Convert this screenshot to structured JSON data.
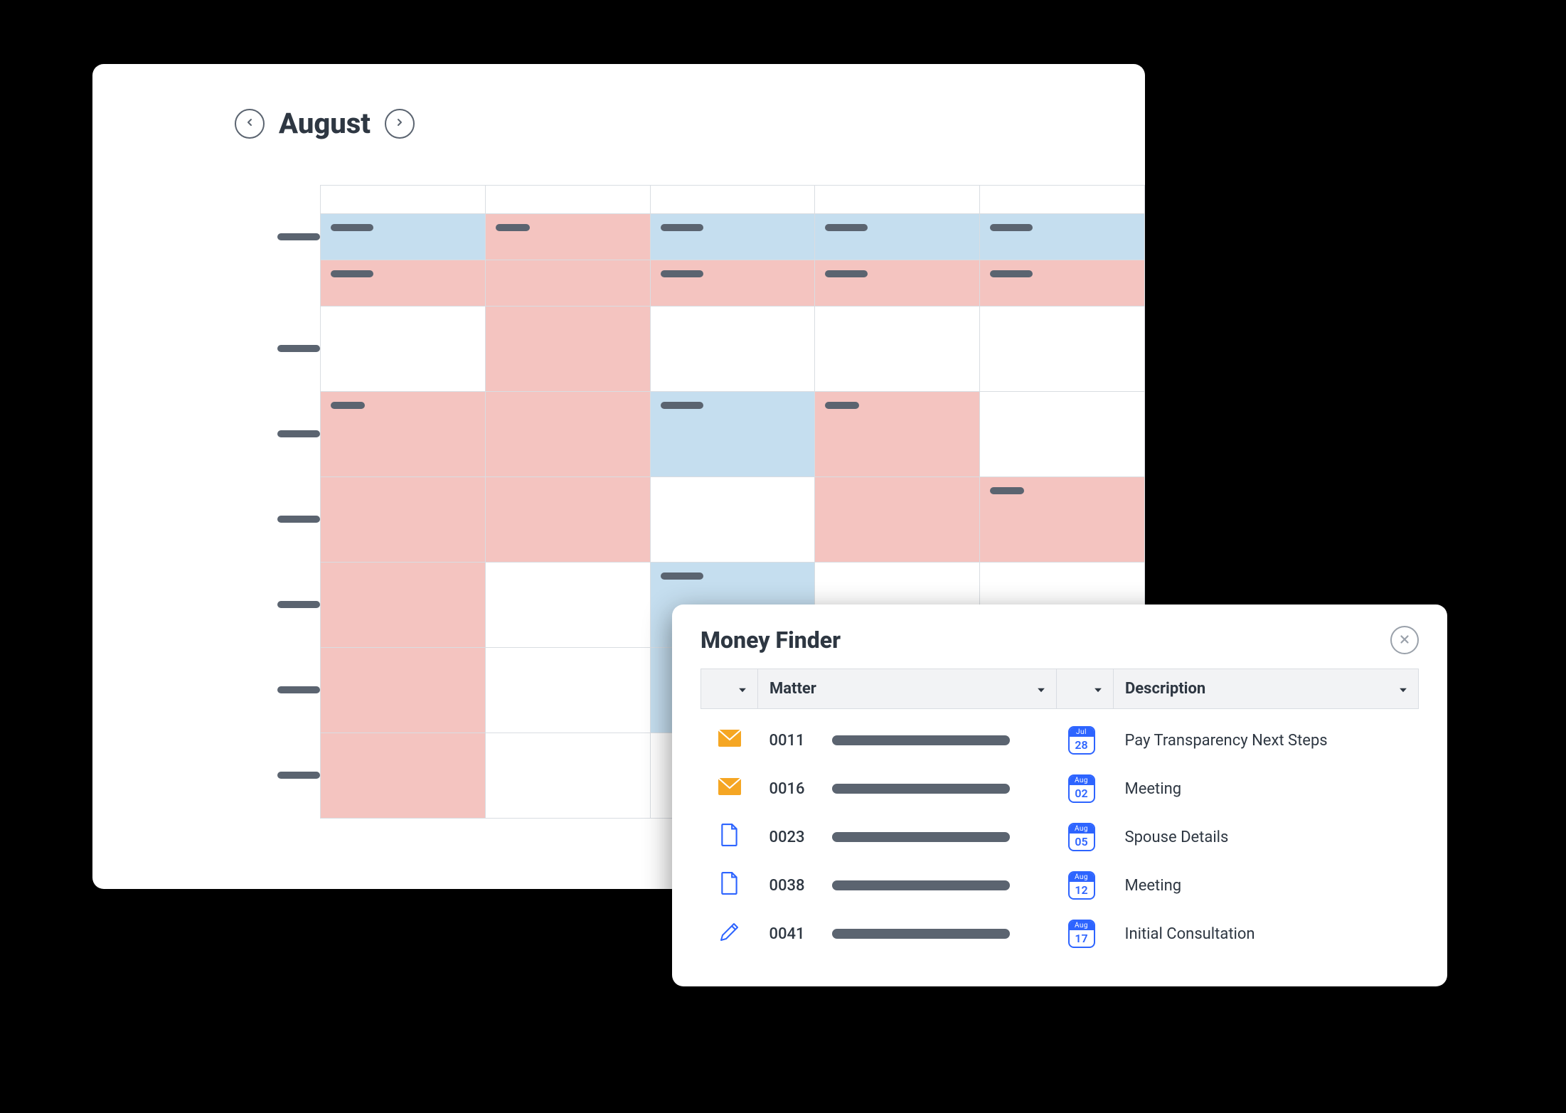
{
  "calendar": {
    "month_label": "August"
  },
  "money_finder": {
    "title": "Money Finder",
    "columns": {
      "matter": "Matter",
      "description": "Description"
    },
    "rows": [
      {
        "icon": "mail",
        "matter_id": "0011",
        "date_month": "Jul",
        "date_day": "28",
        "description": "Pay Transparency Next Steps"
      },
      {
        "icon": "mail",
        "matter_id": "0016",
        "date_month": "Aug",
        "date_day": "02",
        "description": "Meeting"
      },
      {
        "icon": "doc",
        "matter_id": "0023",
        "date_month": "Aug",
        "date_day": "05",
        "description": "Spouse Details"
      },
      {
        "icon": "doc",
        "matter_id": "0038",
        "date_month": "Aug",
        "date_day": "12",
        "description": "Meeting"
      },
      {
        "icon": "pencil",
        "matter_id": "0041",
        "date_month": "Aug",
        "date_day": "17",
        "description": "Initial Consultation"
      }
    ]
  }
}
